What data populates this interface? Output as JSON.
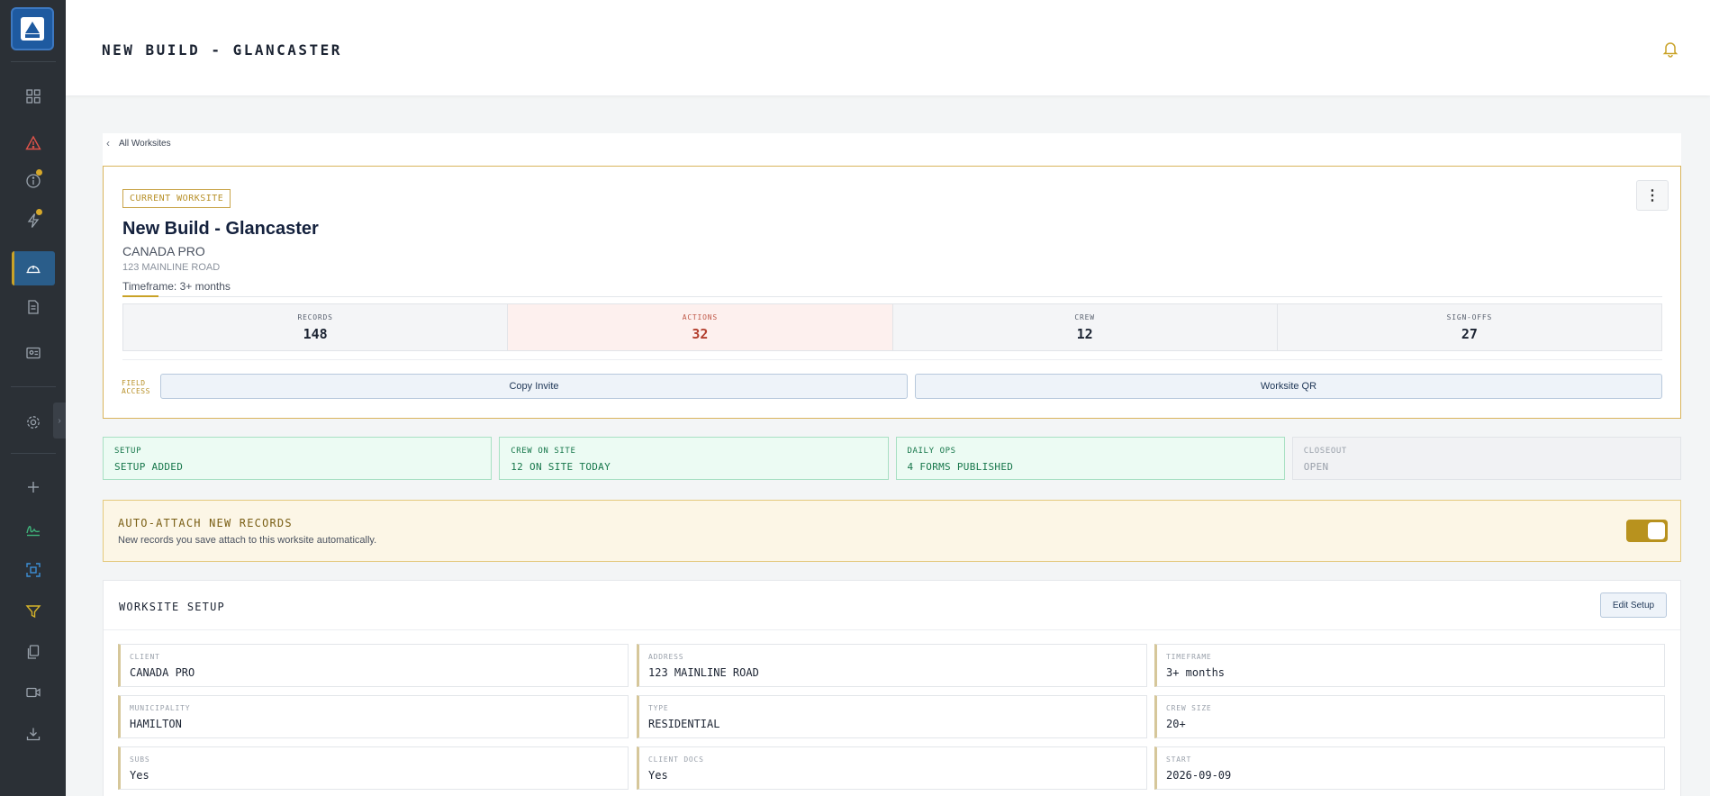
{
  "header": {
    "title": "NEW BUILD - GLANCASTER"
  },
  "breadcrumb": {
    "label": "All Worksites"
  },
  "site": {
    "badge": "CURRENT WORKSITE",
    "name": "New Build - Glancaster",
    "client": "CANADA PRO",
    "address": "123 MAINLINE ROAD",
    "timeframe": "Timeframe: 3+ months",
    "more_glyph": "⋮"
  },
  "stats": [
    {
      "label": "RECORDS",
      "value": "148"
    },
    {
      "label": "ACTIONS",
      "value": "32"
    },
    {
      "label": "CREW",
      "value": "12"
    },
    {
      "label": "SIGN-OFFS",
      "value": "27"
    }
  ],
  "field_access": {
    "label_line1": "FIELD",
    "label_line2": "ACCESS",
    "copy_invite": "Copy Invite",
    "worksite_qr": "Worksite QR"
  },
  "steps": [
    {
      "label": "SETUP",
      "value": "SETUP ADDED"
    },
    {
      "label": "CREW ON SITE",
      "value": "12 ON SITE TODAY"
    },
    {
      "label": "DAILY OPS",
      "value": "4 FORMS PUBLISHED"
    },
    {
      "label": "CLOSEOUT",
      "value": "OPEN"
    }
  ],
  "auto_attach": {
    "title": "AUTO-ATTACH NEW RECORDS",
    "description": "New records you save attach to this worksite automatically.",
    "enabled": true
  },
  "setup": {
    "title": "WORKSITE SETUP",
    "edit_label": "Edit Setup",
    "fields": [
      {
        "label": "CLIENT",
        "value": "CANADA PRO"
      },
      {
        "label": "ADDRESS",
        "value": "123 MAINLINE ROAD"
      },
      {
        "label": "TIMEFRAME",
        "value": "3+ months"
      },
      {
        "label": "MUNICIPALITY",
        "value": "HAMILTON"
      },
      {
        "label": "TYPE",
        "value": "RESIDENTIAL"
      },
      {
        "label": "CREW SIZE",
        "value": "20+"
      },
      {
        "label": "SUBS",
        "value": "Yes"
      },
      {
        "label": "CLIENT DOCS",
        "value": "Yes"
      },
      {
        "label": "START",
        "value": "2026-09-09"
      }
    ]
  },
  "sidebar": {
    "collapse_glyph": "›",
    "icons": [
      "dashboard-icon",
      "alert-triangle-icon",
      "info-icon",
      "lightning-icon",
      "hard-hat-icon",
      "document-icon",
      "id-card-icon",
      "settings-icon",
      "plus-icon",
      "signature-icon",
      "scan-icon",
      "filter-icon",
      "copy-icon",
      "video-icon",
      "download-icon"
    ]
  },
  "colors": {
    "accent": "#c9a227",
    "sidebar": "#2b3036",
    "active": "#2a5d8a",
    "success": "#17774b",
    "danger": "#b3402f"
  }
}
